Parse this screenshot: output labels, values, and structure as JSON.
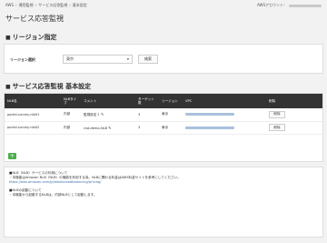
{
  "topbar": {
    "breadcrumb": [
      "AWS",
      "›",
      "運用監視",
      "›",
      "サービス応答監視",
      "›",
      "基本設定"
    ],
    "account_label": "AWSアカウント："
  },
  "page_title": "サービス応答監視",
  "region_section": {
    "title": "リージョン指定",
    "label": "リージョン選択",
    "selected": "東京",
    "search_button": "検索"
  },
  "settings_section": {
    "title": "サービス応答監視 基本設定",
    "headers": [
      "NLB名",
      "NLBタイプ",
      "コメント",
      "ターゲット数",
      "リージョン",
      "VPC",
      "削除"
    ],
    "rows": [
      {
        "name": "portal-survey-nlb01",
        "type": "内部",
        "comment": "監視設定１",
        "targets": "3",
        "region": "東京",
        "delete": "削除"
      },
      {
        "name": "portal-survey-nlb02",
        "type": "内部",
        "comment": "csd-demo-NLB",
        "targets": "3",
        "region": "東京",
        "delete": "削除"
      }
    ],
    "add_button": "+"
  },
  "info": {
    "nlb_head": "■NLB（NLB）サービスの利用について",
    "nlb_line": "・本機能はAmazon NLB（NLB）の機能を利用する為、NLBに関わる料金はAWS料金サイトを参考にしてください。",
    "nlb_link": "https://aws.amazon.com/jp/elasticloadbalancing/pricing/",
    "launch_head": "■NLBの起動について",
    "launch_line": "・本機能から起動するNLBは、内部NLBとして起動します。"
  }
}
